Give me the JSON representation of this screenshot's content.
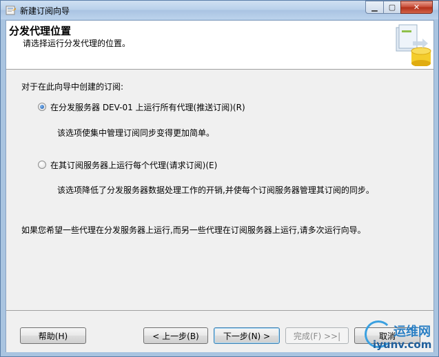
{
  "window": {
    "title": "新建订阅向导",
    "controls": {
      "minimize": "▁",
      "maximize": "▢",
      "close": "✕"
    }
  },
  "header": {
    "title": "分发代理位置",
    "subtitle": "请选择运行分发代理的位置。"
  },
  "body": {
    "question": "对于在此向导中创建的订阅:",
    "options": [
      {
        "label": "在分发服务器 DEV-01 上运行所有代理(推送订阅)(R)",
        "description": "该选项使集中管理订阅同步变得更加简单。",
        "selected": true
      },
      {
        "label": "在其订阅服务器上运行每个代理(请求订阅)(E)",
        "description": "该选项降低了分发服务器数据处理工作的开销,并使每个订阅服务器管理其订阅的同步。",
        "selected": false
      }
    ],
    "note": "如果您希望一些代理在分发服务器上运行,而另一些代理在订阅服务器上运行,请多次运行向导。"
  },
  "footer": {
    "help": "帮助(H)",
    "back": "< 上一步(B)",
    "next": "下一步(N) >",
    "finish": "完成(F) >>|",
    "cancel": "取消"
  },
  "watermark": {
    "line1": "运维网",
    "line2": "iyunv.com"
  },
  "colors": {
    "selected_radio": "#1a57a8",
    "titlebar": "#b8d0ea",
    "close_button": "#c74a34"
  }
}
